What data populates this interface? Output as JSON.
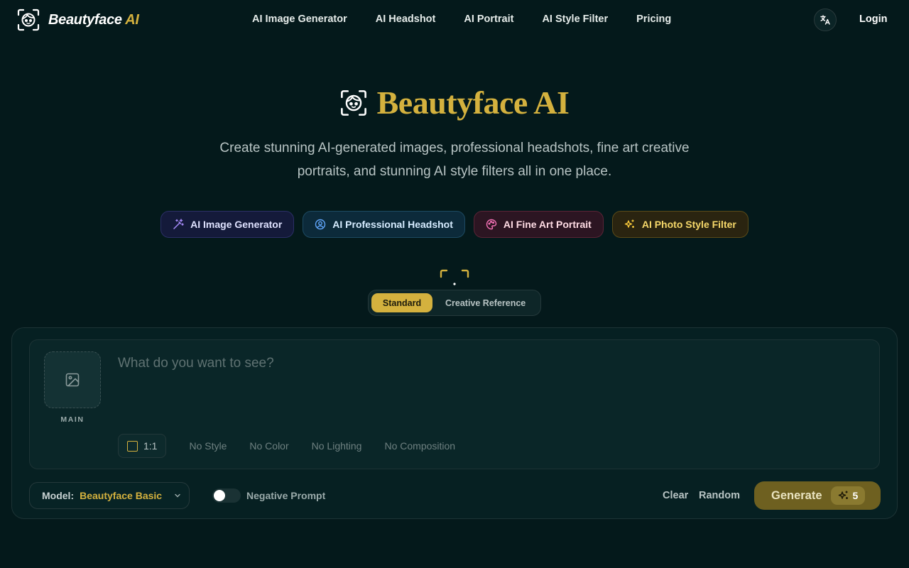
{
  "header": {
    "brand_name": "Beautyface",
    "brand_suffix": "AI",
    "nav": [
      "AI Image Generator",
      "AI Headshot",
      "AI Portrait",
      "AI Style Filter",
      "Pricing"
    ],
    "login": "Login",
    "language_icon": "translate-icon"
  },
  "hero": {
    "title": "Beautyface AI",
    "subtitle_line1": "Create stunning AI-generated images, professional headshots, fine art creative",
    "subtitle_line2": "portraits, and stunning AI style filters all in one place."
  },
  "features": [
    {
      "label": "AI Image Generator",
      "icon": "magic-wand-icon",
      "color": "#a78bfa"
    },
    {
      "label": "AI Professional Headshot",
      "icon": "user-circle-icon",
      "color": "#60a5fa"
    },
    {
      "label": "AI Fine Art Portrait",
      "icon": "palette-icon",
      "color": "#f472b6"
    },
    {
      "label": "AI Photo Style Filter",
      "icon": "sparkles-icon",
      "color": "#f6c83a"
    }
  ],
  "mode": {
    "active": "Standard",
    "inactive": "Creative Reference"
  },
  "generator": {
    "upload_label": "MAIN",
    "prompt_placeholder": "What do you want to see?",
    "ratio": "1:1",
    "style": "No Style",
    "color": "No Color",
    "lighting": "No Lighting",
    "composition": "No Composition",
    "model_label": "Model:",
    "model_value": "Beautyface Basic",
    "negative_prompt": "Negative Prompt",
    "negative_prompt_enabled": false,
    "clear": "Clear",
    "random": "Random",
    "generate": "Generate",
    "credits": "5"
  },
  "colors": {
    "accent": "#d4b13e",
    "background": "#04191b"
  }
}
